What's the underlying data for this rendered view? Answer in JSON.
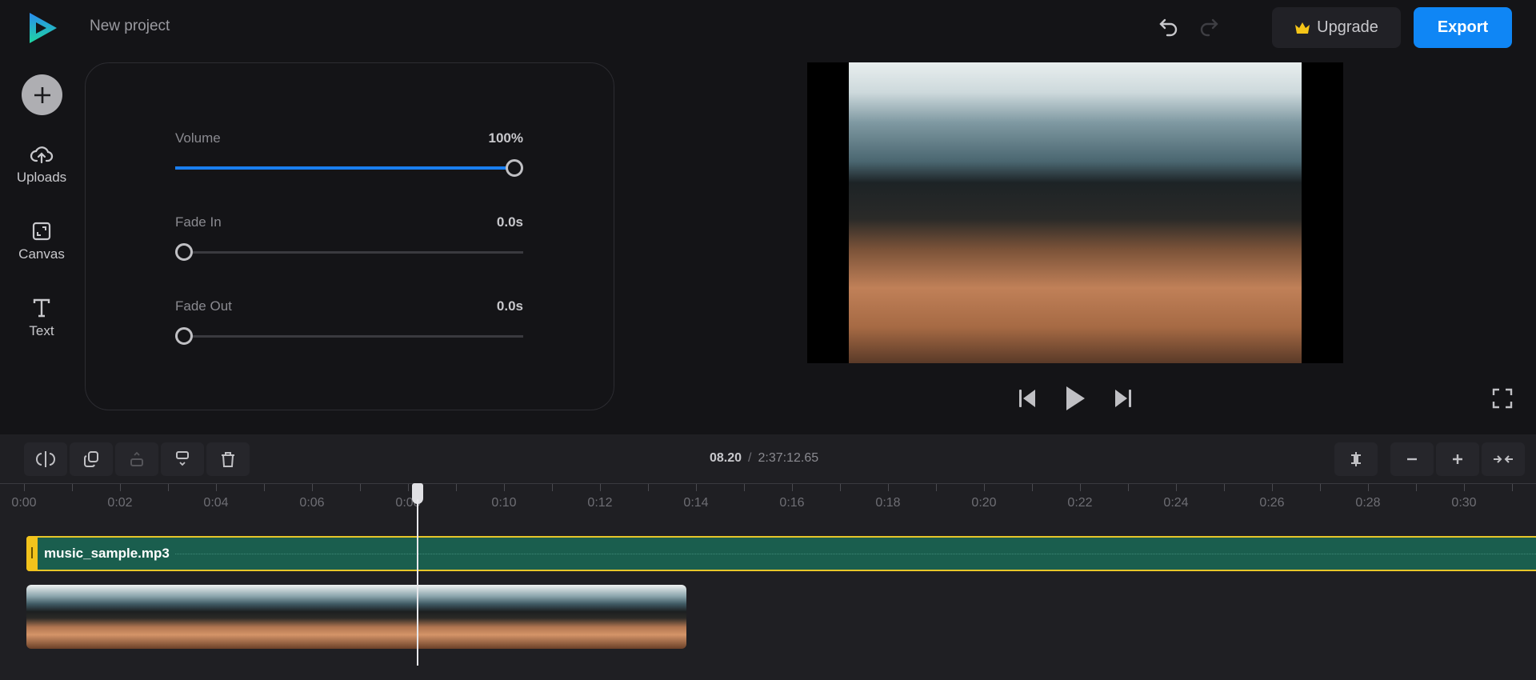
{
  "header": {
    "title": "New project",
    "upgrade_label": "Upgrade",
    "export_label": "Export",
    "accent": "#0f86f5"
  },
  "rail": {
    "items": [
      {
        "label": "Uploads",
        "icon": "cloud-upload-icon"
      },
      {
        "label": "Canvas",
        "icon": "canvas-icon"
      },
      {
        "label": "Text",
        "icon": "text-icon"
      }
    ]
  },
  "audio_panel": {
    "volume": {
      "label": "Volume",
      "value": "100%",
      "fraction": 1.0
    },
    "fade_in": {
      "label": "Fade In",
      "value": "0.0s",
      "fraction": 0
    },
    "fade_out": {
      "label": "Fade Out",
      "value": "0.0s",
      "fraction": 0
    }
  },
  "timeline": {
    "current_time": "08.20",
    "separator": "/",
    "total_time": "2:37:12.65",
    "ruler": [
      "0:00",
      "0:02",
      "0:04",
      "0:06",
      "0:08",
      "0:10",
      "0:12",
      "0:14",
      "0:16",
      "0:18",
      "0:20",
      "0:22",
      "0:24",
      "0:26",
      "0:28",
      "0:30"
    ],
    "playhead_seconds": 8.2,
    "audio_clip": {
      "name": "music_sample.mp3",
      "color": "#1a5e4e",
      "border": "#e6c62a"
    }
  }
}
